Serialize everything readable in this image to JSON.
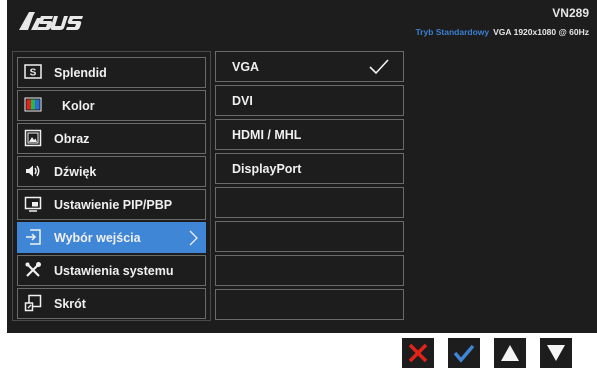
{
  "header": {
    "model": "VN289",
    "mode": "Tryb Standardowy",
    "signal": "VGA  1920x1080 @ 60Hz"
  },
  "colors": {
    "accent": "#3f86d6",
    "mode_text": "#3a7fd0",
    "background": "#1d1d1d",
    "close_key": "#e2231a",
    "confirm_key": "#3f86d6"
  },
  "menu": {
    "items": [
      {
        "label": "Splendid",
        "icon": "splendid-icon"
      },
      {
        "label": "Kolor",
        "icon": "color-palette-icon"
      },
      {
        "label": "Obraz",
        "icon": "image-icon"
      },
      {
        "label": "Dźwięk",
        "icon": "speaker-icon"
      },
      {
        "label": "Ustawienie PIP/PBP",
        "icon": "pip-icon"
      },
      {
        "label": "Wybór wejścia",
        "icon": "input-select-icon",
        "active": true
      },
      {
        "label": "Ustawienia systemu",
        "icon": "tools-icon"
      },
      {
        "label": "Skrót",
        "icon": "shortcut-icon"
      }
    ]
  },
  "submenu": {
    "items": [
      {
        "label": "VGA",
        "selected": true
      },
      {
        "label": "DVI"
      },
      {
        "label": "HDMI / MHL"
      },
      {
        "label": "DisplayPort"
      },
      {
        "label": ""
      },
      {
        "label": ""
      },
      {
        "label": ""
      },
      {
        "label": ""
      }
    ]
  },
  "keys": [
    "close-icon",
    "check-icon",
    "up-arrow-icon",
    "down-arrow-icon"
  ]
}
